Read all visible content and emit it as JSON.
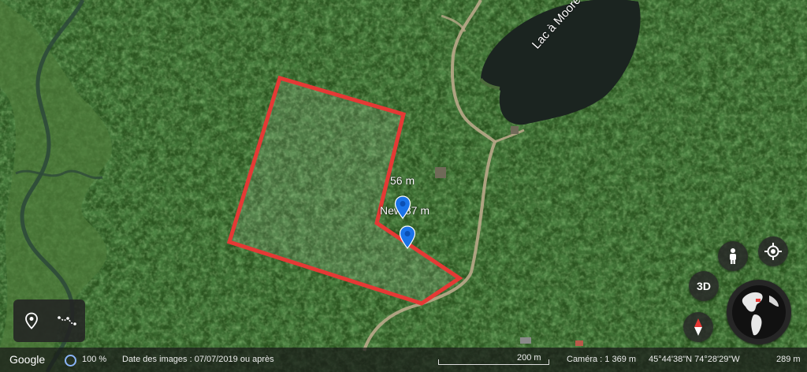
{
  "map": {
    "lake_label": "Lac à Moore",
    "measure_label_a": "56 m",
    "measure_label_b": "New 87 m",
    "boundary_color": "#e53935",
    "pin_color": "#1a73e8"
  },
  "controls": {
    "view_3d_label": "3D",
    "pegman_icon": "pegman-icon",
    "locate_icon": "my-location-icon",
    "compass_icon": "compass-icon",
    "globe_icon": "globe-icon"
  },
  "tools": {
    "placemark_icon": "location-pin-icon",
    "path_icon": "path-icon"
  },
  "status_bar": {
    "brand": "Google",
    "zoom_level": "100 %",
    "imagery_date": "Date des images : 07/07/2019 ou après",
    "scale_label": "200 m",
    "camera_altitude": "Caméra : 1 369 m",
    "coordinates": "45°44'38\"N 74°28'29\"W",
    "elevation": "289 m"
  }
}
